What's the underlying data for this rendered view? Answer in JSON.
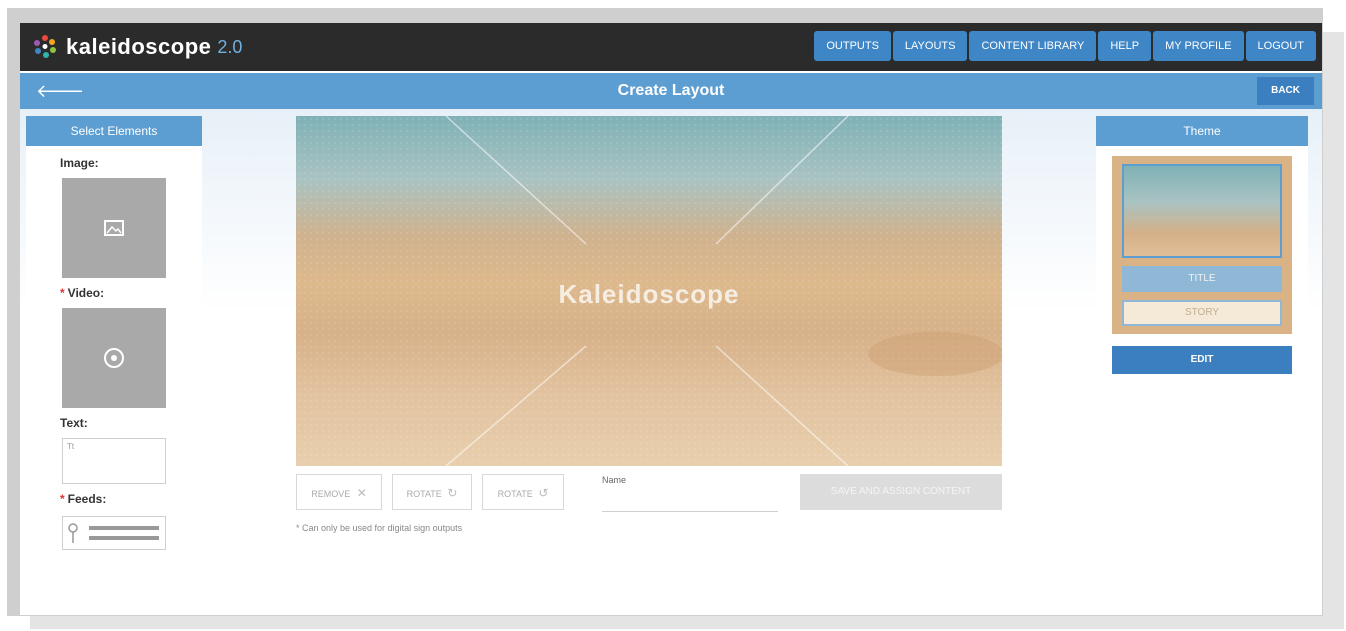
{
  "app": {
    "logo_text": "kaleidoscope",
    "version": "2.0"
  },
  "nav": [
    "OUTPUTS",
    "LAYOUTS",
    "CONTENT LIBRARY",
    "HELP",
    "MY PROFILE",
    "LOGOUT"
  ],
  "subbar": {
    "back_arrow": "🡐",
    "title": "Create Layout",
    "back_label": "BACK"
  },
  "left_panel": {
    "heading": "Select Elements",
    "image_label": "Image:",
    "video_label": "Video:",
    "text_label": "Text:",
    "text_placeholder": "Tt",
    "feeds_label": "Feeds:",
    "required_mark": "*"
  },
  "canvas": {
    "brand_text": "Kaleidoscope"
  },
  "toolbar": {
    "remove_label": "REMOVE",
    "rotate1_label": "ROTATE",
    "rotate2_label": "ROTATE",
    "name_label": "Name",
    "save_label": "SAVE AND ASSIGN CONTENT",
    "note": "* Can only be used for digital sign outputs"
  },
  "theme": {
    "heading": "Theme",
    "title_label": "TITLE",
    "story_label": "STORY",
    "edit_label": "EDIT"
  },
  "colors": {
    "accent": "#5c9dd2",
    "topbar": "#2b2b2b",
    "button": "#3b7fc0"
  }
}
